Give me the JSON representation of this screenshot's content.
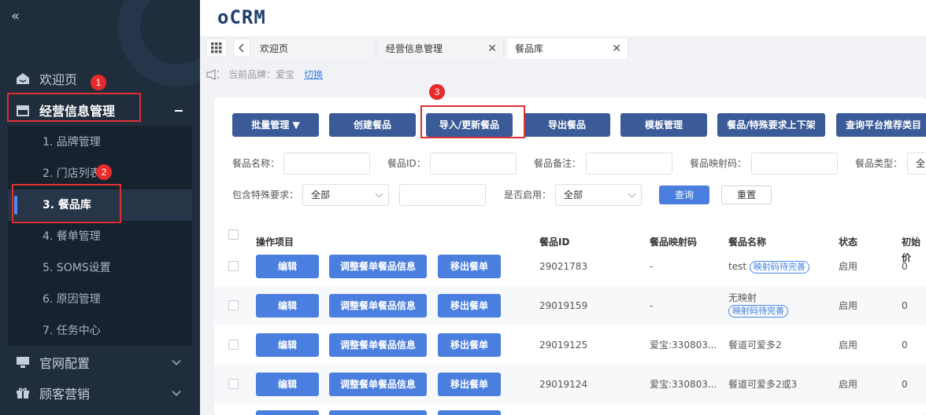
{
  "sidebar": {
    "collapse_icon": "double-chevron-left-icon",
    "items": [
      {
        "label": "欢迎页",
        "icon": "home-icon"
      },
      {
        "label": "经营信息管理",
        "icon": "store-icon"
      },
      {
        "label": "官网配置",
        "icon": "monitor-icon"
      },
      {
        "label": "顾客营销",
        "icon": "gift-icon"
      }
    ],
    "submenu": [
      "1. 品牌管理",
      "2. 门店列表",
      "3. 餐品库",
      "4. 餐单管理",
      "5. SOMS设置",
      "6. 原因管理",
      "7. 任务中心"
    ],
    "active_submenu": "3. 餐品库"
  },
  "badges": [
    "1",
    "2",
    "3"
  ],
  "header": {
    "logo": "oCRM"
  },
  "tabs": {
    "grid_icon": "grid-icon",
    "back_icon": "chevron-left-icon",
    "items": [
      {
        "label": "欢迎页"
      },
      {
        "label": "经营信息管理",
        "close": "✕"
      },
      {
        "label": "餐品库",
        "close": "✕"
      }
    ]
  },
  "brand": {
    "icon": "speaker-icon",
    "label": "当前品牌：爱宝",
    "switch": "切换"
  },
  "toolbar": {
    "buttons": [
      "批量管理 ▼",
      "创建餐品",
      "导入/更新餐品",
      "导出餐品",
      "模板管理",
      "餐品/特殊要求上下架",
      "查询平台推荐类目"
    ]
  },
  "filters": {
    "name_label": "餐品名称：",
    "id_label": "餐品ID：",
    "note_label": "餐品备注：",
    "map_label": "餐品映射码：",
    "type_label": "餐品类型：",
    "type_value": "全",
    "special_label": "包含特殊要求：",
    "special_value": "全部",
    "enabled_label": "是否启用：",
    "enabled_value": "全部",
    "query": "查询",
    "reset": "重置"
  },
  "table": {
    "headers": [
      "操作项目",
      "餐品ID",
      "餐品映射码",
      "餐品名称",
      "状态",
      "初始价"
    ],
    "actions": [
      "编辑",
      "调整餐单餐品信息",
      "移出餐单"
    ],
    "rows": [
      {
        "id": "29021783",
        "map": "-",
        "name": "test",
        "tag": "映射码待完善",
        "status": "启用",
        "price": "0"
      },
      {
        "id": "29019159",
        "map": "-",
        "name": "无映射",
        "tag": "映射码待完善",
        "status": "启用",
        "price": "0"
      },
      {
        "id": "29019125",
        "map": "爱宝:330803...",
        "name": "餐道可爱多2",
        "tag": "",
        "status": "启用",
        "price": "0"
      },
      {
        "id": "29019124",
        "map": "爱宝:330803...",
        "name": "餐道可爱多2或3",
        "tag": "",
        "status": "启用",
        "price": "0"
      }
    ]
  },
  "colors": {
    "sidebar_bg": "#1f2d3d",
    "primary_button": "#3a5a98",
    "row_button": "#4b7fdf",
    "highlight": "#e03030"
  }
}
